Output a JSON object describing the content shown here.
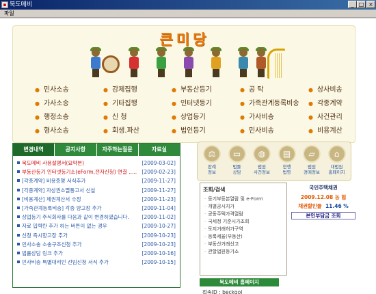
{
  "window": {
    "title": "북도메비",
    "minimize": "_",
    "maximize": "□",
    "close": "×"
  },
  "menu": {
    "file": "파일"
  },
  "banner": {
    "logo": "큰미당",
    "services": [
      [
        "민사소송",
        "강제집행",
        "부동산등기",
        "공        탁",
        "상사비송"
      ],
      [
        "가사소송",
        "기타집행",
        "인터넷등기",
        "가족관계등록비송",
        "각종계약"
      ],
      [
        "행정소송",
        "신        청",
        "상업등기",
        "가사비송",
        "사건관리"
      ],
      [
        "형사소송",
        "회생.파산",
        "법인등기",
        "민사비송",
        "비용계산"
      ]
    ]
  },
  "news": {
    "tabs": [
      "변경내역",
      "공지사항",
      "자주하는질문",
      "자료실"
    ],
    "items": [
      {
        "title": "북도메비 사용설명서(요약본)",
        "date": "[2009-03-02]",
        "color": "#d01010"
      },
      {
        "title": "부동산등기 인터넷등기소(eForm,전자신청) 연결 .....",
        "date": "[2009-02-23]",
        "color": "#d01010"
      },
      {
        "title": "[각종계약] 비용증명 서식추가",
        "date": "[2009-11-27]",
        "color": "#2d5ba8"
      },
      {
        "title": "[각종계약] 자상권소멸통고서 신설",
        "date": "[2009-11-27]",
        "color": "#2d5ba8"
      },
      {
        "title": "[비용계산] 체권계산서 수정",
        "date": "[2009-11-23]",
        "color": "#2d5ba8"
      },
      {
        "title": "[가족관계등록비송] 각종 양고장 추가",
        "date": "[2009-11-04]",
        "color": "#2d5ba8"
      },
      {
        "title": "상업등기 주식회사를 다음과 같이 변경하였습니다.",
        "date": "[2009-11-02]",
        "color": "#2d5ba8"
      },
      {
        "title": "자료 입력란 추가 하는 버튼이 없는 경우",
        "date": "[2009-10-27]",
        "color": "#2d5ba8"
      },
      {
        "title": "신청 즉시항고장 추가",
        "date": "[2009-10-23]",
        "color": "#2d5ba8"
      },
      {
        "title": "민사소송 소송구조신청 추가",
        "date": "[2009-10-23]",
        "color": "#2d5ba8"
      },
      {
        "title": "법률상담 링크 추가",
        "date": "[2009-10-16]",
        "color": "#2d5ba8"
      },
      {
        "title": "민사비송 특별대리인 선임신청 서식 추가",
        "date": "[2009-10-15]",
        "color": "#2d5ba8"
      }
    ]
  },
  "shortcuts": [
    {
      "label": "판례\n정보",
      "icon": "scales-icon",
      "glyph": "⚖"
    },
    {
      "label": "법률\n상담",
      "icon": "computer-icon",
      "glyph": "▭"
    },
    {
      "label": "법원\n사건정보",
      "icon": "globe-icon",
      "glyph": "◍"
    },
    {
      "label": "현행\n법령",
      "icon": "book-icon",
      "glyph": "▤"
    },
    {
      "label": "법원\n경매정보",
      "icon": "folder-icon",
      "glyph": "▱"
    },
    {
      "label": "대법원\n홈페이지",
      "icon": "court-building-icon",
      "glyph": "⌂"
    }
  ],
  "search": {
    "heading": "조회/검색",
    "items": [
      "등기부등본열람 및 e-Form",
      "개별공시지가",
      "공동주택가격열람",
      "국세청 기준시가조회",
      "토지거래허가구역",
      "등록세율(부동산)",
      "부동산거래신고",
      "관할법원등기소"
    ]
  },
  "rate": {
    "title": "국민주택채권",
    "date": "2009.12.08 농    협",
    "discount_label": "채권할인율",
    "discount_value": "11.46 %",
    "button": "본인부담금 조회"
  },
  "home_button": "북도메비 홈페이지",
  "access": "접속ID : beckgol"
}
